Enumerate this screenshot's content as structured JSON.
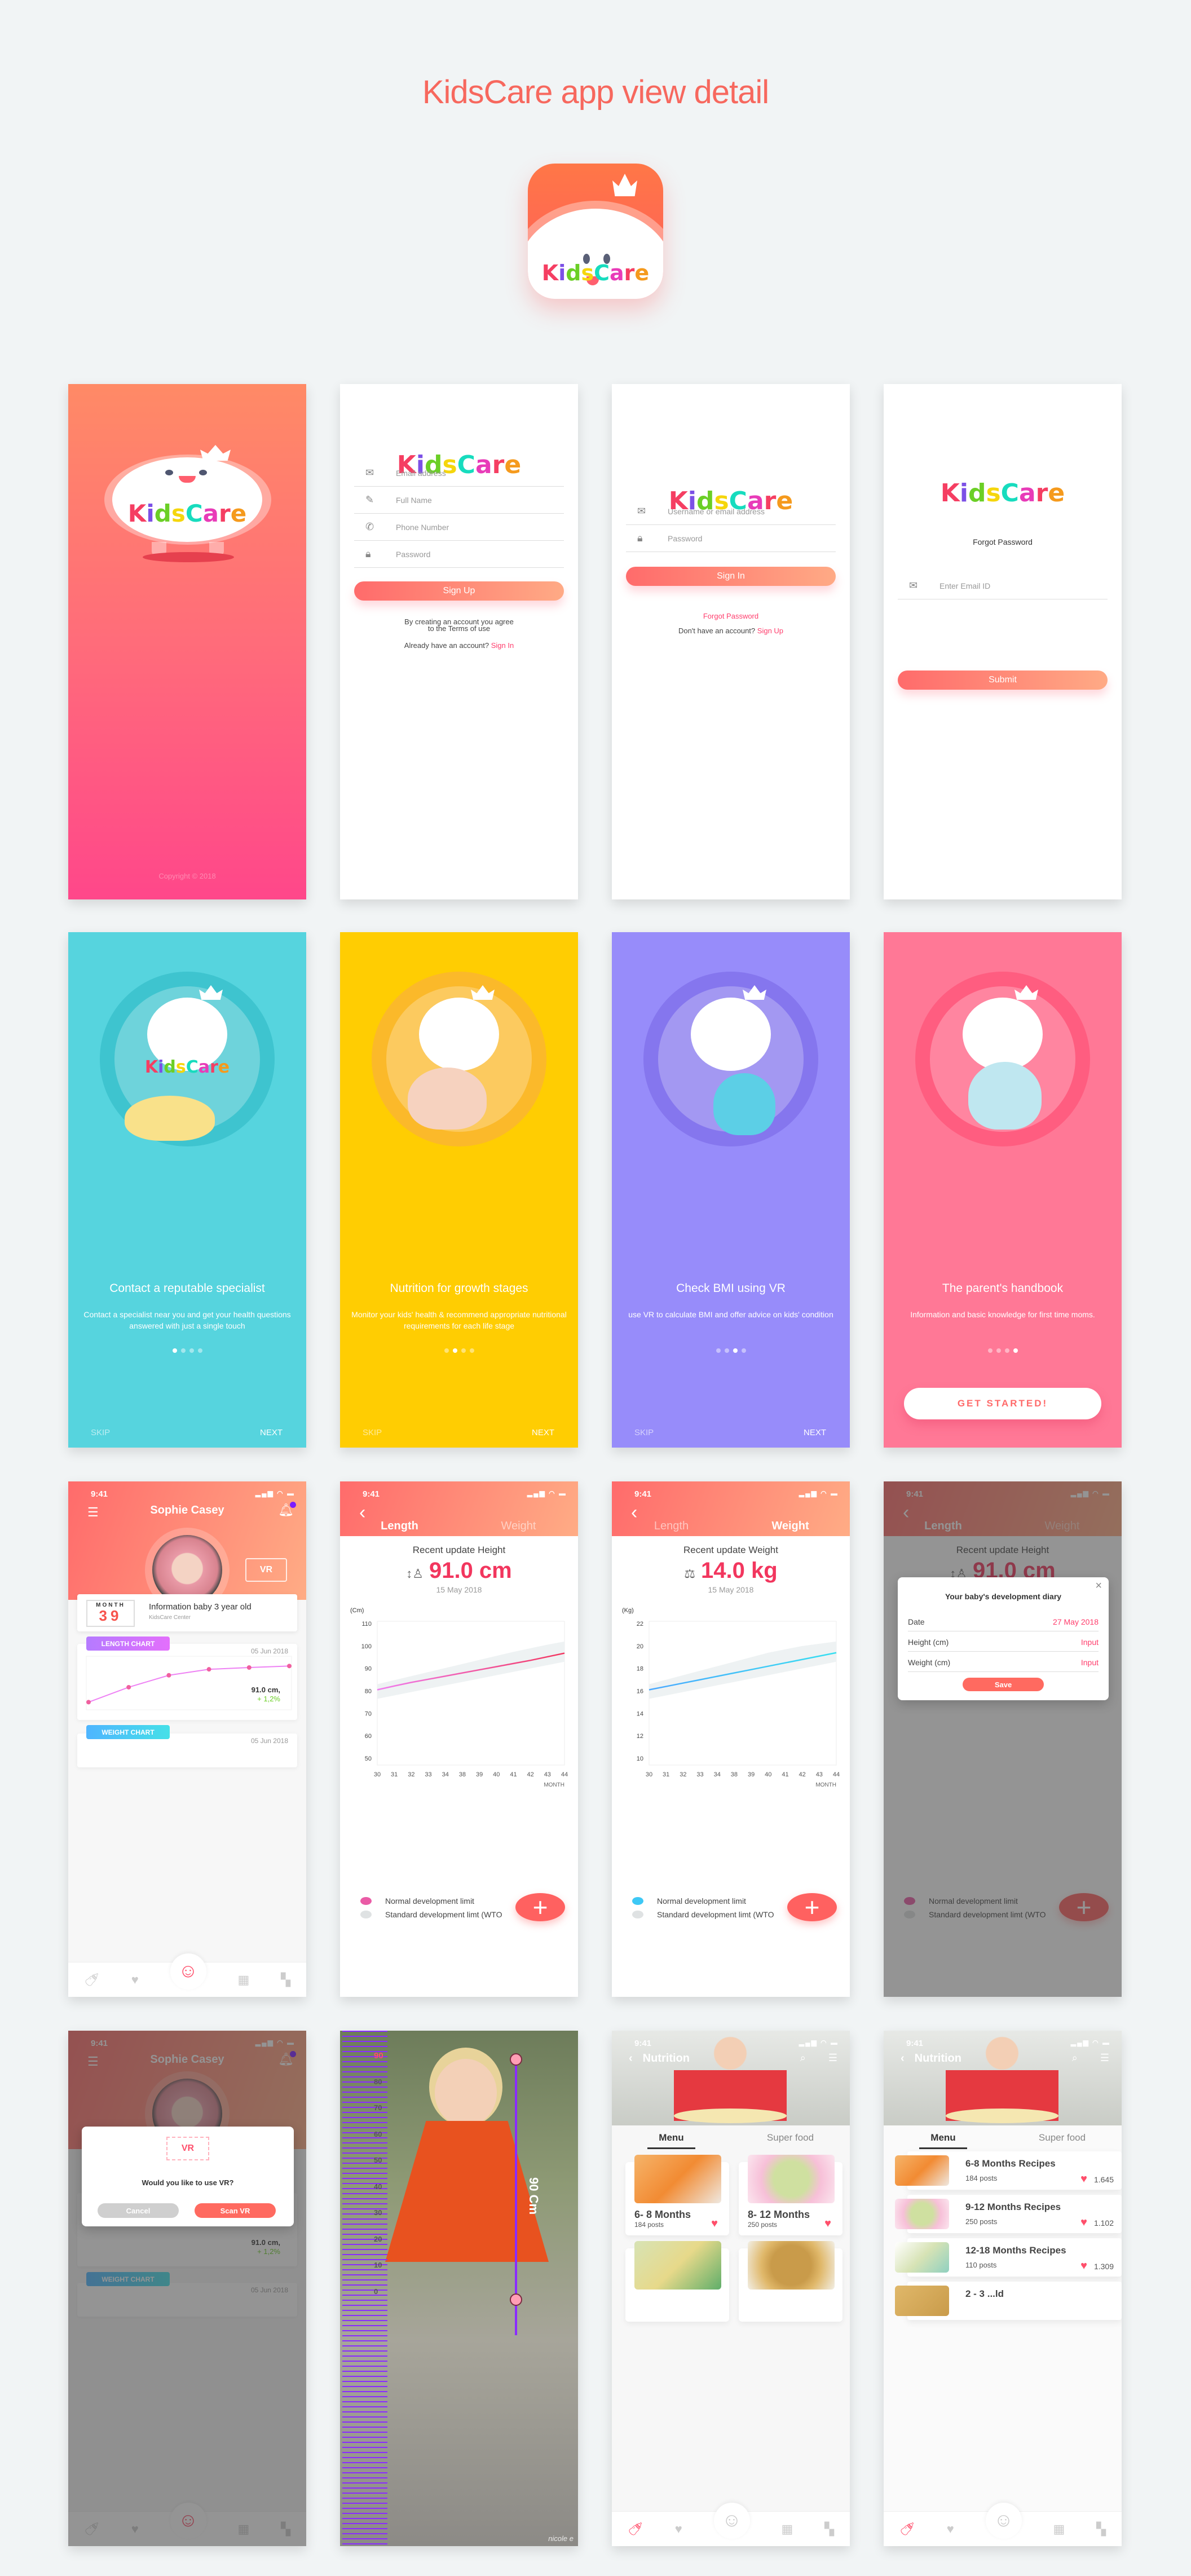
{
  "page": {
    "title": "KidsCare app view detail",
    "brand_colors": {
      "coral": "#ff6b6b",
      "peach": "#ffac85",
      "pink": "#ff3d6c",
      "teal": "#56d4de",
      "yellow": "#ffcd02",
      "violet": "#978cfa",
      "rose": "#ff7896"
    }
  },
  "logo": {
    "letters": [
      "K",
      "i",
      "d",
      "s",
      "C",
      "a",
      "r",
      "e"
    ],
    "text": "KidsCare"
  },
  "splash": {
    "copyright": "Copyright © 2018"
  },
  "signup": {
    "fields": [
      {
        "icon": "mail-icon",
        "placeholder": "Email address"
      },
      {
        "icon": "pencil-icon",
        "placeholder": "Full Name"
      },
      {
        "icon": "phone-icon",
        "placeholder": "Phone Number"
      },
      {
        "icon": "lock-icon",
        "placeholder": "Password"
      }
    ],
    "button": "Sign Up",
    "terms_line1": "By creating an account you agree",
    "terms_line2": "to the Terms of use",
    "have_account": "Already have an account?",
    "signin_link": "Sign In"
  },
  "signin": {
    "fields": [
      {
        "icon": "mail-icon",
        "placeholder": "Username or email address"
      },
      {
        "icon": "lock-icon",
        "placeholder": "Password"
      }
    ],
    "button": "Sign In",
    "forgot": "Forgot Password",
    "no_account": "Don't have an account?",
    "signup_link": "Sign Up"
  },
  "forgot": {
    "title": "Forgot Password",
    "field": {
      "icon": "mail-icon",
      "placeholder": "Enter Email ID"
    },
    "button": "Submit"
  },
  "onboarding": [
    {
      "title": "Contact a reputable specialist",
      "text": "Contact a specialist near you and get your health questions answered with just a single touch",
      "active_dot": 0,
      "skip": "SKIP",
      "next": "NEXT",
      "color": "#56d4de"
    },
    {
      "title": "Nutrition for growth stages",
      "text": "Monitor your kids' health & recommend appropriate nutritional requirements for each life stage",
      "active_dot": 1,
      "skip": "SKIP",
      "next": "NEXT",
      "color": "#ffcd02"
    },
    {
      "title": "Check BMI using VR",
      "text": "use VR to calculate BMI and offer advice on kids' condition",
      "active_dot": 2,
      "skip": "SKIP",
      "next": "NEXT",
      "color": "#978cfa"
    },
    {
      "title": "The parent's handbook",
      "text": "Information and basic knowledge for first time moms.",
      "active_dot": 3,
      "button": "GET STARTED!",
      "color": "#ff7896"
    }
  ],
  "status_bar": {
    "time": "9:41"
  },
  "home": {
    "name": "Sophie Casey",
    "vr_label": "VR",
    "month_label": "MONTH",
    "month_value": "39",
    "info_title": "Information baby 3 year old",
    "info_sub": "KidsCare Center",
    "length_badge": "LENGTH CHART",
    "weight_badge": "WEIGHT CHART",
    "chart_date": "05 Jun 2018",
    "current_value": "91.0 cm,",
    "change": "+ 1,2%"
  },
  "growth": {
    "tabs": [
      "Length",
      "Weight"
    ],
    "length": {
      "heading": "Recent update Height",
      "value": "91.0 cm",
      "date": "15 May 2018",
      "unit": "(Cm)"
    },
    "weight": {
      "heading": "Recent update Weight",
      "value": "14.0 kg",
      "date": "15 May 2018",
      "unit": "(Kg)"
    },
    "x_label": "MONTH",
    "legend": [
      "Normal development limit",
      "Standard development limt (WTO"
    ]
  },
  "diary_modal": {
    "title": "Your baby's development diary",
    "rows": [
      {
        "label": "Date",
        "value": "27 May 2018"
      },
      {
        "label": "Height (cm)",
        "value": "Input"
      },
      {
        "label": "Weight (cm)",
        "value": "Input"
      }
    ],
    "save": "Save"
  },
  "vr_modal": {
    "question": "Would you like to use VR?",
    "cancel": "Cancel",
    "confirm": "Scan VR"
  },
  "vr_measure": {
    "ruler_labels": [
      "90",
      "80",
      "70",
      "60",
      "50",
      "40",
      "30",
      "20",
      "10",
      "0"
    ],
    "reading": "90 Cm",
    "watermark": "nicole e"
  },
  "nutrition": {
    "title": "Nutrition",
    "tabs": [
      "Menu",
      "Super food"
    ],
    "grid": [
      {
        "title": "6- 8 Months",
        "posts": "184 posts"
      },
      {
        "title": "8- 12 Months",
        "posts": "250 posts"
      }
    ],
    "list": [
      {
        "title": "6-8  Months Recipes",
        "posts": "184 posts",
        "likes": "1.645"
      },
      {
        "title": "9-12 Months Recipes",
        "posts": "250 posts",
        "likes": "1.102"
      },
      {
        "title": "12-18 Months Recipes",
        "posts": "110 posts",
        "likes": "1.309"
      },
      {
        "title": "2 - 3 ...ld",
        "posts": "",
        "likes": ""
      }
    ]
  },
  "chart_data": [
    {
      "type": "line",
      "title": "LENGTH CHART",
      "x": [
        1,
        2,
        3,
        4,
        5,
        6
      ],
      "series": [
        {
          "name": "Length",
          "values": [
            78,
            83,
            87,
            89,
            89.6,
            90.1
          ]
        }
      ],
      "annotation": "91.0 cm, + 1,2%",
      "xlabel": "",
      "ylabel": "",
      "ylim": [
        76,
        93
      ]
    },
    {
      "type": "line",
      "title": "Recent update Height",
      "xlabel": "MONTH",
      "ylabel": "(Cm)",
      "categories": [
        "30",
        "31",
        "32",
        "33",
        "34",
        "38",
        "39",
        "40",
        "41",
        "42",
        "43",
        "44"
      ],
      "yticks": [
        50,
        60,
        70,
        80,
        90,
        100,
        110
      ],
      "ylim": [
        47,
        111
      ],
      "series": [
        {
          "name": "Normal development limit",
          "values": [
            80.5,
            82.2,
            83.8,
            85.2,
            86.6,
            88.0,
            89.4,
            90.8,
            92.2,
            93.6,
            95.2,
            96.8
          ]
        },
        {
          "name": "Standard development limt (WTO) lower",
          "values": [
            76.5,
            78.0,
            79.5,
            81.0,
            82.5,
            84.0,
            85.5,
            87.0,
            88.5,
            90.0,
            91.5,
            93.0
          ]
        },
        {
          "name": "Standard development limt (WTO) upper",
          "values": [
            83.0,
            84.8,
            86.6,
            88.4,
            90.2,
            92.0,
            93.8,
            95.6,
            97.4,
            99.0,
            100.6,
            102.0
          ]
        }
      ]
    },
    {
      "type": "line",
      "title": "Recent update Weight",
      "xlabel": "MONTH",
      "ylabel": "(Kg)",
      "categories": [
        "30",
        "31",
        "32",
        "33",
        "34",
        "38",
        "39",
        "40",
        "41",
        "42",
        "43",
        "44"
      ],
      "yticks": [
        10,
        12,
        14,
        16,
        18,
        20,
        22
      ],
      "ylim": [
        9.4,
        22.2
      ],
      "series": [
        {
          "name": "Normal development limit",
          "values": [
            16.1,
            16.4,
            16.7,
            17.0,
            17.3,
            17.6,
            17.9,
            18.2,
            18.5,
            18.8,
            19.1,
            19.4
          ]
        },
        {
          "name": "Standard development limt (WTO) lower",
          "values": [
            15.3,
            15.6,
            15.9,
            16.2,
            16.5,
            16.8,
            17.1,
            17.4,
            17.7,
            18.0,
            18.3,
            18.6
          ]
        },
        {
          "name": "Standard development limt (WTO) upper",
          "values": [
            16.6,
            17.0,
            17.4,
            17.8,
            18.2,
            18.6,
            19.0,
            19.4,
            19.7,
            20.0,
            20.2,
            20.4
          ]
        }
      ]
    }
  ]
}
